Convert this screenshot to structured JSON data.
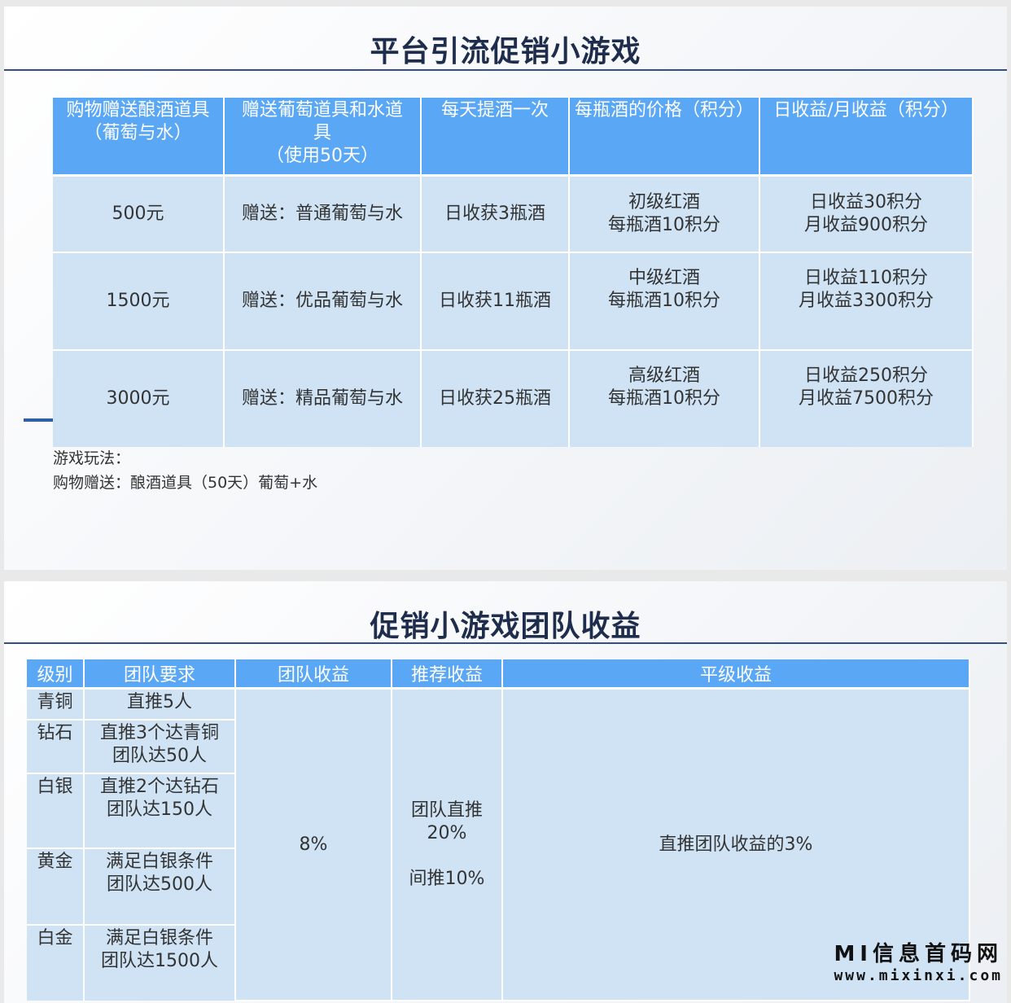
{
  "slide1": {
    "title": "平台引流促销小游戏",
    "table": {
      "headers": [
        [
          "购物赠送酿酒道具",
          "（葡萄与水）"
        ],
        [
          "赠送葡萄道具和水道",
          "具",
          "（使用50天）"
        ],
        [
          "每天提酒一次"
        ],
        [
          "每瓶酒的价格（积分）"
        ],
        [
          "日收益/月收益（积分）"
        ]
      ],
      "rows": [
        {
          "price": "500元",
          "gift": "赠送：普通葡萄与水",
          "daily": "日收获3瓶酒",
          "wine": [
            "初级红酒",
            "每瓶酒10积分"
          ],
          "income": [
            "日收益30积分",
            "月收益900积分"
          ]
        },
        {
          "price": "1500元",
          "gift": "赠送：优品葡萄与水",
          "daily": "日收获11瓶酒",
          "wine": [
            "中级红酒",
            "每瓶酒10积分"
          ],
          "income": [
            "日收益110积分",
            "月收益3300积分"
          ]
        },
        {
          "price": "3000元",
          "gift": "赠送：精品葡萄与水",
          "daily": "日收获25瓶酒",
          "wine": [
            "高级红酒",
            "每瓶酒10积分"
          ],
          "income": [
            "日收益250积分",
            "月收益7500积分"
          ]
        }
      ]
    },
    "notes": [
      "游戏玩法：",
      "购物赠送：酿酒道具（50天）葡萄+水"
    ]
  },
  "slide2": {
    "title": "促销小游戏团队收益",
    "table": {
      "headers": [
        "级别",
        "团队要求",
        "团队收益",
        "推荐收益",
        "平级收益"
      ],
      "levels": [
        {
          "level": "青铜",
          "req": [
            "直推5人"
          ]
        },
        {
          "level": "钻石",
          "req": [
            "直推3个达青铜",
            "团队达50人"
          ]
        },
        {
          "level": "白银",
          "req": [
            "直推2个达钻石",
            "团队达150人"
          ]
        },
        {
          "level": "黄金",
          "req": [
            "满足白银条件",
            "团队达500人"
          ]
        },
        {
          "level": "白金",
          "req": [
            "满足白银条件",
            "团队达1500人"
          ]
        }
      ],
      "team_income": "8%",
      "referral": [
        "团队直推",
        "20%",
        "间推10%"
      ],
      "peer": "直推团队收益的3%"
    }
  },
  "watermark": {
    "line1": "MI信息首码网",
    "line2": "www.mixinxi.com"
  },
  "colors": {
    "header_bg": "#5aa7f5",
    "cell_bg": "#cfe3f4",
    "title": "#1f2d4d",
    "rule": "#2f4f85"
  }
}
